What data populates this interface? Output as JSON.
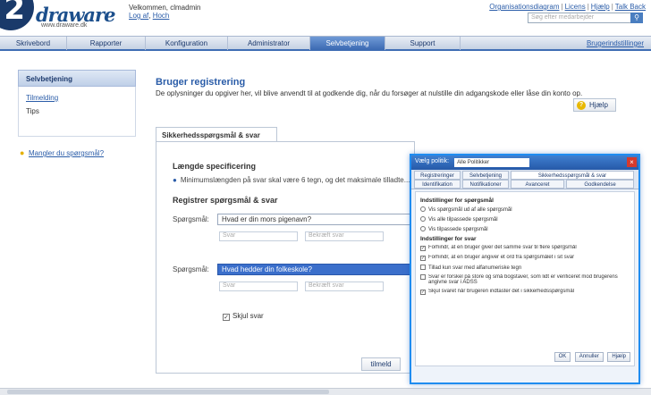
{
  "step": "2",
  "header": {
    "logo_text": "draware",
    "logo_sub": "www.draware.dk",
    "welcome_line1": "Velkommen, clmadmin",
    "welcome_link1": "Log af",
    "welcome_link2": "Hoch",
    "top_links": [
      "Organisationsdiagram",
      "Licens",
      "Hjælp",
      "Talk Back"
    ],
    "search_placeholder": "Søg efter medarbejder"
  },
  "nav": {
    "items": [
      "Skrivebord",
      "Rapporter",
      "Konfiguration",
      "Administrator",
      "Selvbetjening",
      "Support"
    ],
    "active_index": 4,
    "right_link": "Brugerindstillinger"
  },
  "sidebar": {
    "title": "Selvbetjening",
    "link": "Tilmelding",
    "text": "Tips",
    "question_link": "Mangler du spørgsmål?"
  },
  "main": {
    "title": "Bruger registrering",
    "description": "De oplysninger du opgiver her, vil blive anvendt til at godkende dig, når du forsøger at nulstille din adgangskode eller låse din konto op.",
    "help_label": "Hjælp",
    "panel_tab": "Sikkerhedsspørgsmål & svar",
    "length_heading": "Længde specificering",
    "length_bullet": "Minimumslængden på svar skal være 6 tegn, og det maksimale tilladte...",
    "register_heading": "Registrer spørgsmål & svar",
    "question_label": "Spørgsmål:",
    "question1_value": "Hvad er din mors pigenavn?",
    "question2_value": "Hvad hedder din folkeskole?",
    "answer_placeholder": "Svar",
    "confirm_placeholder": "Bekræft svar",
    "show_answers_label": "Skjul svar",
    "submit_label": "tilmeld"
  },
  "dialog": {
    "title_label": "Vælg politik:",
    "policy_value": "Alle Politikker",
    "tabs": [
      "Registreringer",
      "Selvbetjening",
      "Sikkerhedsspørgsmål & svar",
      "Identifikation",
      "Notifikationer",
      "Avanceret",
      "Godkendelse"
    ],
    "active_tab": 2,
    "section1_title": "Indstillinger for spørgsmål",
    "opt1": "Vis spørgsmål ud af alle spørgsmål",
    "opt2": "Vis alle tilpassede spørgsmål",
    "opt3": "Vis tilpassede spørgsmål",
    "section2_title": "Indstillinger for svar",
    "opt4": "Forhindr, at en bruger giver det samme svar til flere spørgsmål",
    "opt5": "Forhindr, at en bruger angiver et ord fra spørgsmålet i sit svar",
    "opt6": "Tillad kun svar med alfanumeriske tegn",
    "opt7": "Svar er forskel på store og små bogstaver, som lidt er verificeret mod brugerens angivne svar i ADSS",
    "opt8": "Skjul svaret når brugeren indtaster det i sikkerhedsspørgsmål",
    "buttons": [
      "OK",
      "Annuller",
      "Hjælp"
    ]
  }
}
